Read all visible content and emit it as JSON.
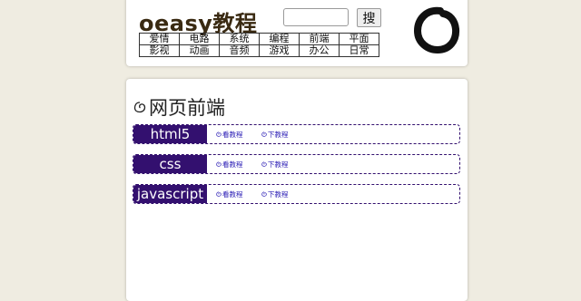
{
  "header": {
    "title": "oeasy教程",
    "search": {
      "value": "",
      "button_label": "搜"
    },
    "nav_rows": [
      [
        "爱情",
        "电路",
        "系统",
        "编程",
        "前端",
        "平面"
      ],
      [
        "影视",
        "动画",
        "音频",
        "游戏",
        "办公",
        "日常"
      ]
    ],
    "logo_icon": "enso-circle-icon"
  },
  "main": {
    "section_title": "网页前端",
    "rows": [
      {
        "label": "html5",
        "link_view": "看教程",
        "link_download": "下教程"
      },
      {
        "label": "css",
        "link_view": "看教程",
        "link_download": "下教程"
      },
      {
        "label": "javascript",
        "link_view": "看教程",
        "link_download": "下教程"
      }
    ]
  },
  "colors": {
    "background": "#efece1",
    "accent": "#33106f",
    "link": "#2b1eb5",
    "title": "#3a2a12"
  }
}
